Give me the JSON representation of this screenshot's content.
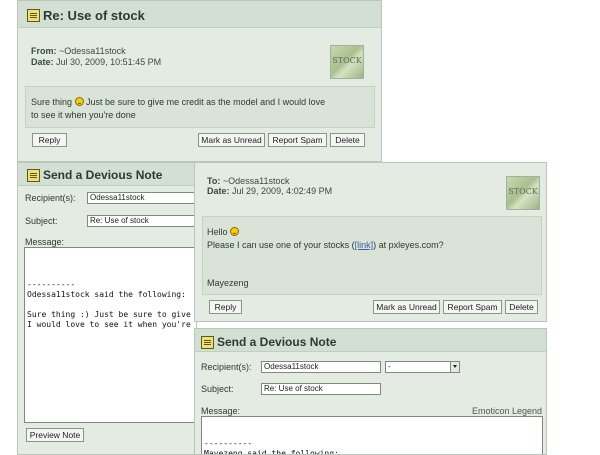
{
  "reply_top": {
    "title": "Re: Use of stock",
    "from_label": "From:",
    "from_value": "~Odessa11stock",
    "date_label": "Date:",
    "date_value": "Jul 30, 2009, 10:51:45 PM",
    "avatar_text": "STOCK",
    "message_part1": "Sure thing",
    "message_part2": " Just be sure to give me credit as the model and I would love",
    "message_line2": "to see it when you're done",
    "buttons": {
      "reply": "Reply",
      "mark_unread": "Mark as Unread",
      "report_spam": "Report Spam",
      "delete": "Delete"
    }
  },
  "note_left": {
    "title": "Send a Devious Note",
    "recipient_label": "Recipient(s):",
    "recipient_value": "Odessa11stock",
    "subject_label": "Subject:",
    "subject_value": "Re: Use of stock",
    "message_label": "Message:",
    "message_text": "\n\n\n----------\nOdessa11stock said the following:\n\nSure thing :) Just be sure to give me credit as the model and\nI would love to see it when you're done",
    "preview_button": "Preview Note"
  },
  "original_msg": {
    "to_label": "To:",
    "to_value": "~Odessa11stock",
    "date_label": "Date:",
    "date_value": "Jul 29, 2009, 4:02:49 PM",
    "avatar_text": "STOCK",
    "greeting": "Hello",
    "line2_before": "Please I can use one of your stocks (",
    "link_text": "[link]",
    "line2_after": ") at pxleyes.com?",
    "signature": "Mayezeng",
    "buttons": {
      "reply": "Reply",
      "mark_unread": "Mark as Unread",
      "report_spam": "Report Spam",
      "delete": "Delete"
    }
  },
  "note_right": {
    "title": "Send a Devious Note",
    "recipient_label": "Recipient(s):",
    "recipient_value": "Odessa11stock",
    "select_value": "-",
    "subject_label": "Subject:",
    "subject_value": "Re: Use of stock",
    "message_label": "Message:",
    "emoticon_legend": "Emoticon Legend",
    "message_text": "\n\n----------\nMayezeng said the following:"
  }
}
